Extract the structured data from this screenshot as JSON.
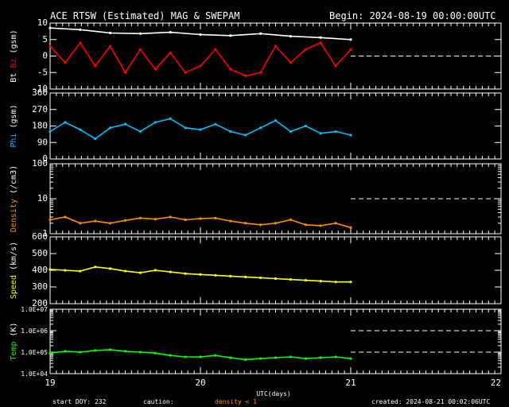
{
  "header": {
    "title": "ACE RTSW (Estimated) MAG & SWEPAM",
    "begin": "Begin: 2024-08-19 00:00:00UTC"
  },
  "footer": {
    "start_doy": "start DOY: 232",
    "caution": "caution:",
    "density_note": "density < 1",
    "created": "created: 2024-08-21 00:02:06UTC"
  },
  "colors": {
    "background": "#000000",
    "axes": "#ffffff",
    "bt": "#ffffff",
    "bz": "#ff0000",
    "phi": "#00bfff",
    "density": "#ff8c00",
    "speed": "#ffff00",
    "temp": "#00ff00"
  },
  "chart_data": [
    {
      "type": "scatter",
      "panel": "mag",
      "ylabel_parts": [
        "Bt",
        "Bz",
        "(gsm)"
      ],
      "xlim": [
        19,
        22
      ],
      "ylim": [
        -10,
        10
      ],
      "yticks": [
        "10",
        "5",
        "0",
        "-5",
        "-10"
      ],
      "ytick_values": [
        10,
        5,
        0,
        -5,
        -10
      ],
      "dashed_lines": [
        0
      ],
      "series": [
        {
          "name": "Bt",
          "color": "#ffffff",
          "x": [
            19.0,
            19.2,
            19.4,
            19.6,
            19.8,
            20.0,
            20.2,
            20.4,
            20.6,
            20.8,
            21.0
          ],
          "y": [
            8.5,
            8.0,
            7.0,
            6.8,
            7.2,
            6.5,
            6.2,
            6.8,
            6.0,
            5.6,
            5.0
          ]
        },
        {
          "name": "Bz",
          "color": "#ff0000",
          "x": [
            19.0,
            19.1,
            19.2,
            19.3,
            19.4,
            19.5,
            19.6,
            19.7,
            19.8,
            19.9,
            20.0,
            20.1,
            20.2,
            20.3,
            20.4,
            20.5,
            20.6,
            20.7,
            20.8,
            20.9,
            21.0
          ],
          "y": [
            3,
            -2,
            4,
            -3,
            3,
            -5,
            2,
            -4,
            1,
            -5,
            -3,
            2,
            -4,
            -6,
            -5,
            3,
            -2,
            2,
            4,
            -3,
            2
          ]
        }
      ]
    },
    {
      "type": "scatter",
      "panel": "phi",
      "ylabel_parts": [
        "Phi",
        "(gsm)"
      ],
      "xlim": [
        19,
        22
      ],
      "ylim": [
        0,
        360
      ],
      "yticks": [
        "360",
        "270",
        "180",
        "90",
        "0"
      ],
      "ytick_values": [
        360,
        270,
        180,
        90,
        0
      ],
      "series": [
        {
          "name": "Phi",
          "color": "#00bfff",
          "x": [
            19.0,
            19.1,
            19.2,
            19.3,
            19.4,
            19.5,
            19.6,
            19.7,
            19.8,
            19.9,
            20.0,
            20.1,
            20.2,
            20.3,
            20.4,
            20.5,
            20.6,
            20.7,
            20.8,
            20.9,
            21.0
          ],
          "y": [
            150,
            200,
            160,
            110,
            170,
            190,
            150,
            200,
            220,
            170,
            160,
            190,
            150,
            130,
            170,
            210,
            150,
            180,
            140,
            150,
            130
          ]
        }
      ]
    },
    {
      "type": "scatter",
      "panel": "density",
      "ylabel_parts": [
        "Density",
        "(/cm3)"
      ],
      "xlim": [
        19,
        22
      ],
      "ylim": [
        1,
        100
      ],
      "scale": "log",
      "yticks": [
        "100",
        "10",
        "1"
      ],
      "ytick_values": [
        100,
        10,
        1
      ],
      "dashed_lines": [
        10
      ],
      "series": [
        {
          "name": "Density",
          "color": "#ff8c00",
          "x": [
            19.0,
            19.1,
            19.2,
            19.3,
            19.4,
            19.5,
            19.6,
            19.7,
            19.8,
            19.9,
            20.0,
            20.1,
            20.2,
            20.3,
            20.4,
            20.5,
            20.6,
            20.7,
            20.8,
            20.9,
            21.0
          ],
          "y": [
            2.5,
            3.0,
            2.0,
            2.3,
            2.0,
            2.4,
            2.8,
            2.6,
            3.0,
            2.5,
            2.7,
            2.8,
            2.3,
            2.0,
            1.8,
            2.0,
            2.5,
            1.8,
            1.7,
            2.0,
            1.5
          ]
        }
      ]
    },
    {
      "type": "scatter",
      "panel": "speed",
      "ylabel_parts": [
        "Speed",
        "(km/s)"
      ],
      "xlim": [
        19,
        22
      ],
      "ylim": [
        200,
        600
      ],
      "yticks": [
        "600",
        "500",
        "400",
        "300",
        "200"
      ],
      "ytick_values": [
        600,
        500,
        400,
        300,
        200
      ],
      "series": [
        {
          "name": "Speed",
          "color": "#ffff00",
          "x": [
            19.0,
            19.1,
            19.2,
            19.3,
            19.4,
            19.5,
            19.6,
            19.7,
            19.8,
            19.9,
            20.0,
            20.1,
            20.2,
            20.3,
            20.4,
            20.5,
            20.6,
            20.7,
            20.8,
            20.9,
            21.0
          ],
          "y": [
            405,
            400,
            395,
            420,
            410,
            395,
            385,
            400,
            390,
            380,
            375,
            370,
            365,
            360,
            355,
            350,
            345,
            340,
            335,
            330,
            330
          ]
        }
      ]
    },
    {
      "type": "scatter",
      "panel": "temp",
      "ylabel_parts": [
        "Temp",
        "(K)"
      ],
      "xlim": [
        19,
        22
      ],
      "ylim": [
        10000,
        10000000
      ],
      "scale": "log",
      "yticks": [
        "1.0E+07",
        "1.0E+06",
        "1.0E+05",
        "1.0E+04"
      ],
      "ytick_values": [
        10000000,
        1000000,
        100000,
        10000
      ],
      "dashed_lines": [
        1000000,
        100000
      ],
      "series": [
        {
          "name": "Temp",
          "color": "#00ff00",
          "x": [
            19.0,
            19.1,
            19.2,
            19.3,
            19.4,
            19.5,
            19.6,
            19.7,
            19.8,
            19.9,
            20.0,
            20.1,
            20.2,
            20.3,
            20.4,
            20.5,
            20.6,
            20.7,
            20.8,
            20.9,
            21.0
          ],
          "y": [
            90000,
            110000,
            100000,
            120000,
            130000,
            110000,
            100000,
            90000,
            70000,
            60000,
            60000,
            70000,
            55000,
            45000,
            50000,
            55000,
            60000,
            50000,
            55000,
            60000,
            50000
          ]
        }
      ]
    }
  ],
  "x_axis": {
    "label": "UTC(days)",
    "ticks": [
      "19",
      "20",
      "21",
      "22"
    ],
    "tick_values": [
      19,
      20,
      21,
      22
    ]
  }
}
